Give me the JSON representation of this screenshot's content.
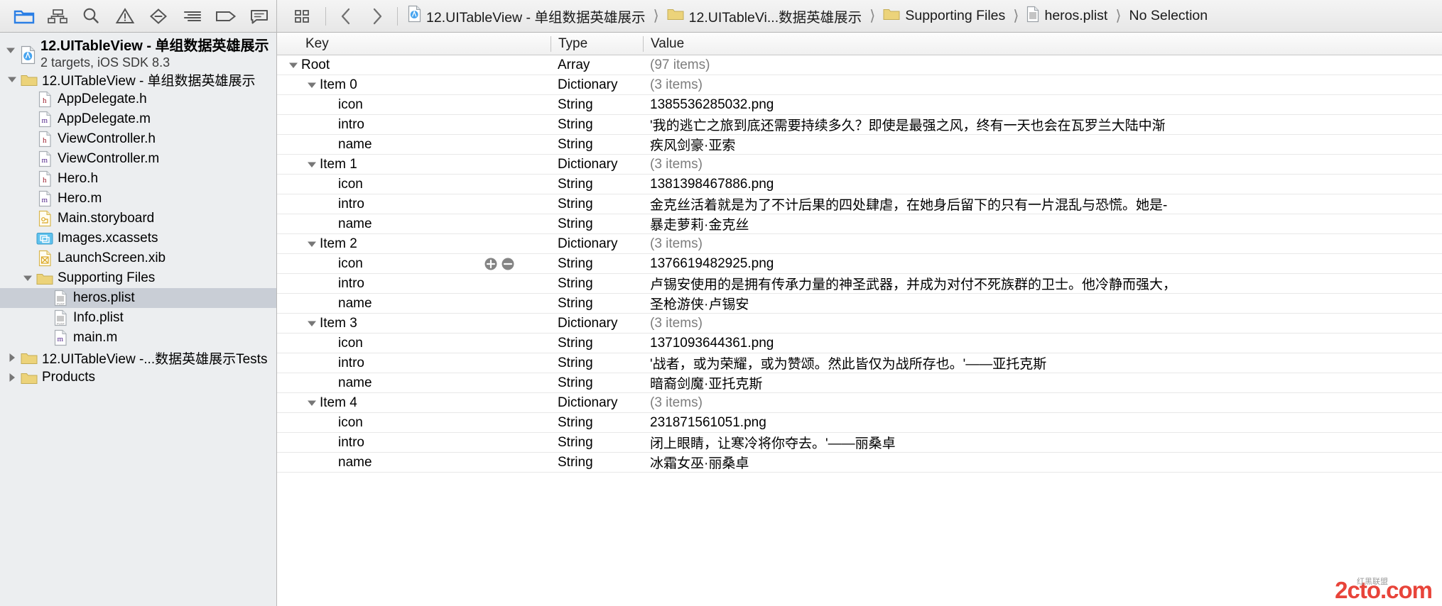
{
  "toolbar": {
    "left_buttons": [
      {
        "name": "folder-icon",
        "label": "Project navigator",
        "active": true
      },
      {
        "name": "hierarchy-icon",
        "label": "Symbol navigator",
        "active": false
      },
      {
        "name": "search-icon",
        "label": "Find navigator",
        "active": false
      },
      {
        "name": "warning-triangle-icon",
        "label": "Issue navigator",
        "active": false
      },
      {
        "name": "diamond-minus-icon",
        "label": "Test navigator",
        "active": false
      },
      {
        "name": "lines-icon",
        "label": "Debug navigator",
        "active": false
      },
      {
        "name": "tag-icon",
        "label": "Breakpoint navigator",
        "active": false
      },
      {
        "name": "speech-bubble-icon",
        "label": "Report navigator",
        "active": false
      }
    ],
    "editor_buttons": [
      {
        "name": "related-items-icon",
        "label": "Related items"
      },
      {
        "name": "back-chevron-icon",
        "label": "Go back"
      },
      {
        "name": "forward-chevron-icon",
        "label": "Go forward"
      }
    ]
  },
  "breadcrumb": [
    {
      "icon": "xcode-project-icon",
      "label": "12.UITableView - 单组数据英雄展示"
    },
    {
      "icon": "folder-icon",
      "label": "12.UITableVi...数据英雄展示"
    },
    {
      "icon": "folder-icon",
      "label": "Supporting Files"
    },
    {
      "icon": "plist-file-icon",
      "label": "heros.plist"
    },
    {
      "icon": "none",
      "label": "No Selection"
    }
  ],
  "navigator": {
    "project": {
      "title": "12.UITableView - 单组数据英雄展示",
      "subtitle": "2 targets, iOS SDK 8.3",
      "icon": "xcode-project-icon",
      "expanded": true
    },
    "items": [
      {
        "label": "12.UITableView - 单组数据英雄展示",
        "icon": "folder-icon",
        "indent": 1,
        "twisty": "down",
        "selected": false
      },
      {
        "label": "AppDelegate.h",
        "icon": "header-file-icon",
        "indent": 2,
        "twisty": "none",
        "selected": false
      },
      {
        "label": "AppDelegate.m",
        "icon": "impl-file-icon",
        "indent": 2,
        "twisty": "none",
        "selected": false
      },
      {
        "label": "ViewController.h",
        "icon": "header-file-icon",
        "indent": 2,
        "twisty": "none",
        "selected": false
      },
      {
        "label": "ViewController.m",
        "icon": "impl-file-icon",
        "indent": 2,
        "twisty": "none",
        "selected": false
      },
      {
        "label": "Hero.h",
        "icon": "header-file-icon",
        "indent": 2,
        "twisty": "none",
        "selected": false
      },
      {
        "label": "Hero.m",
        "icon": "impl-file-icon",
        "indent": 2,
        "twisty": "none",
        "selected": false
      },
      {
        "label": "Main.storyboard",
        "icon": "storyboard-icon",
        "indent": 2,
        "twisty": "none",
        "selected": false
      },
      {
        "label": "Images.xcassets",
        "icon": "assets-icon",
        "indent": 2,
        "twisty": "none",
        "selected": false
      },
      {
        "label": "LaunchScreen.xib",
        "icon": "xib-icon",
        "indent": 2,
        "twisty": "none",
        "selected": false
      },
      {
        "label": "Supporting Files",
        "icon": "folder-icon",
        "indent": 2,
        "twisty": "down",
        "selected": false
      },
      {
        "label": "heros.plist",
        "icon": "plist-file-icon",
        "indent": 3,
        "twisty": "none",
        "selected": true
      },
      {
        "label": "Info.plist",
        "icon": "plist-file-icon",
        "indent": 3,
        "twisty": "none",
        "selected": false
      },
      {
        "label": "main.m",
        "icon": "impl-file-icon",
        "indent": 3,
        "twisty": "none",
        "selected": false
      },
      {
        "label": "12.UITableView -...数据英雄展示Tests",
        "icon": "folder-icon",
        "indent": 1,
        "twisty": "right",
        "selected": false
      },
      {
        "label": "Products",
        "icon": "folder-icon",
        "indent": 1,
        "twisty": "right",
        "selected": false
      }
    ]
  },
  "plist": {
    "columns": {
      "key": "Key",
      "type": "Type",
      "value": "Value"
    },
    "rows": [
      {
        "key": "Root",
        "indent": 0,
        "twisty": "down",
        "type": "Array",
        "value": "(97 items)",
        "muted": true,
        "pm": false
      },
      {
        "key": "Item 0",
        "indent": 1,
        "twisty": "down",
        "type": "Dictionary",
        "value": "(3 items)",
        "muted": true,
        "pm": false
      },
      {
        "key": "icon",
        "indent": 2,
        "twisty": "none",
        "type": "String",
        "value": "1385536285032.png",
        "muted": false,
        "pm": false
      },
      {
        "key": "intro",
        "indent": 2,
        "twisty": "none",
        "type": "String",
        "value": "'我的逃亡之旅到底还需要持续多久？即使是最强之风，终有一天也会在瓦罗兰大陆中渐",
        "muted": false,
        "pm": false
      },
      {
        "key": "name",
        "indent": 2,
        "twisty": "none",
        "type": "String",
        "value": "疾风剑豪·亚索",
        "muted": false,
        "pm": false
      },
      {
        "key": "Item 1",
        "indent": 1,
        "twisty": "down",
        "type": "Dictionary",
        "value": "(3 items)",
        "muted": true,
        "pm": false
      },
      {
        "key": "icon",
        "indent": 2,
        "twisty": "none",
        "type": "String",
        "value": "1381398467886.png",
        "muted": false,
        "pm": false
      },
      {
        "key": "intro",
        "indent": 2,
        "twisty": "none",
        "type": "String",
        "value": "金克丝活着就是为了不计后果的四处肆虐，在她身后留下的只有一片混乱与恐慌。她是-",
        "muted": false,
        "pm": false
      },
      {
        "key": "name",
        "indent": 2,
        "twisty": "none",
        "type": "String",
        "value": "暴走萝莉·金克丝",
        "muted": false,
        "pm": false
      },
      {
        "key": "Item 2",
        "indent": 1,
        "twisty": "down",
        "type": "Dictionary",
        "value": "(3 items)",
        "muted": true,
        "pm": false
      },
      {
        "key": "icon",
        "indent": 2,
        "twisty": "none",
        "type": "String",
        "value": "1376619482925.png",
        "muted": false,
        "pm": true
      },
      {
        "key": "intro",
        "indent": 2,
        "twisty": "none",
        "type": "String",
        "value": "卢锡安使用的是拥有传承力量的神圣武器，并成为对付不死族群的卫士。他冷静而强大，",
        "muted": false,
        "pm": false
      },
      {
        "key": "name",
        "indent": 2,
        "twisty": "none",
        "type": "String",
        "value": "圣枪游侠·卢锡安",
        "muted": false,
        "pm": false
      },
      {
        "key": "Item 3",
        "indent": 1,
        "twisty": "down",
        "type": "Dictionary",
        "value": "(3 items)",
        "muted": true,
        "pm": false
      },
      {
        "key": "icon",
        "indent": 2,
        "twisty": "none",
        "type": "String",
        "value": "1371093644361.png",
        "muted": false,
        "pm": false
      },
      {
        "key": "intro",
        "indent": 2,
        "twisty": "none",
        "type": "String",
        "value": "'战者，或为荣耀，或为赞颂。然此皆仅为战所存也。'——亚托克斯",
        "muted": false,
        "pm": false
      },
      {
        "key": "name",
        "indent": 2,
        "twisty": "none",
        "type": "String",
        "value": "暗裔剑魔·亚托克斯",
        "muted": false,
        "pm": false
      },
      {
        "key": "Item 4",
        "indent": 1,
        "twisty": "down",
        "type": "Dictionary",
        "value": "(3 items)",
        "muted": true,
        "pm": false
      },
      {
        "key": "icon",
        "indent": 2,
        "twisty": "none",
        "type": "String",
        "value": "231871561051.png",
        "muted": false,
        "pm": false
      },
      {
        "key": "intro",
        "indent": 2,
        "twisty": "none",
        "type": "String",
        "value": "闭上眼睛，让寒冷将你夺去。'——丽桑卓",
        "muted": false,
        "pm": false
      },
      {
        "key": "name",
        "indent": 2,
        "twisty": "none",
        "type": "String",
        "value": "冰霜女巫·丽桑卓",
        "muted": false,
        "pm": false
      }
    ]
  },
  "watermark": {
    "main": "2cto.com",
    "sub": "红黑联盟"
  },
  "colors": {
    "accent": "#2b7fe5",
    "selection": "#c9ced6",
    "folder": "#ecd37a",
    "watermark": "#e8443a"
  }
}
